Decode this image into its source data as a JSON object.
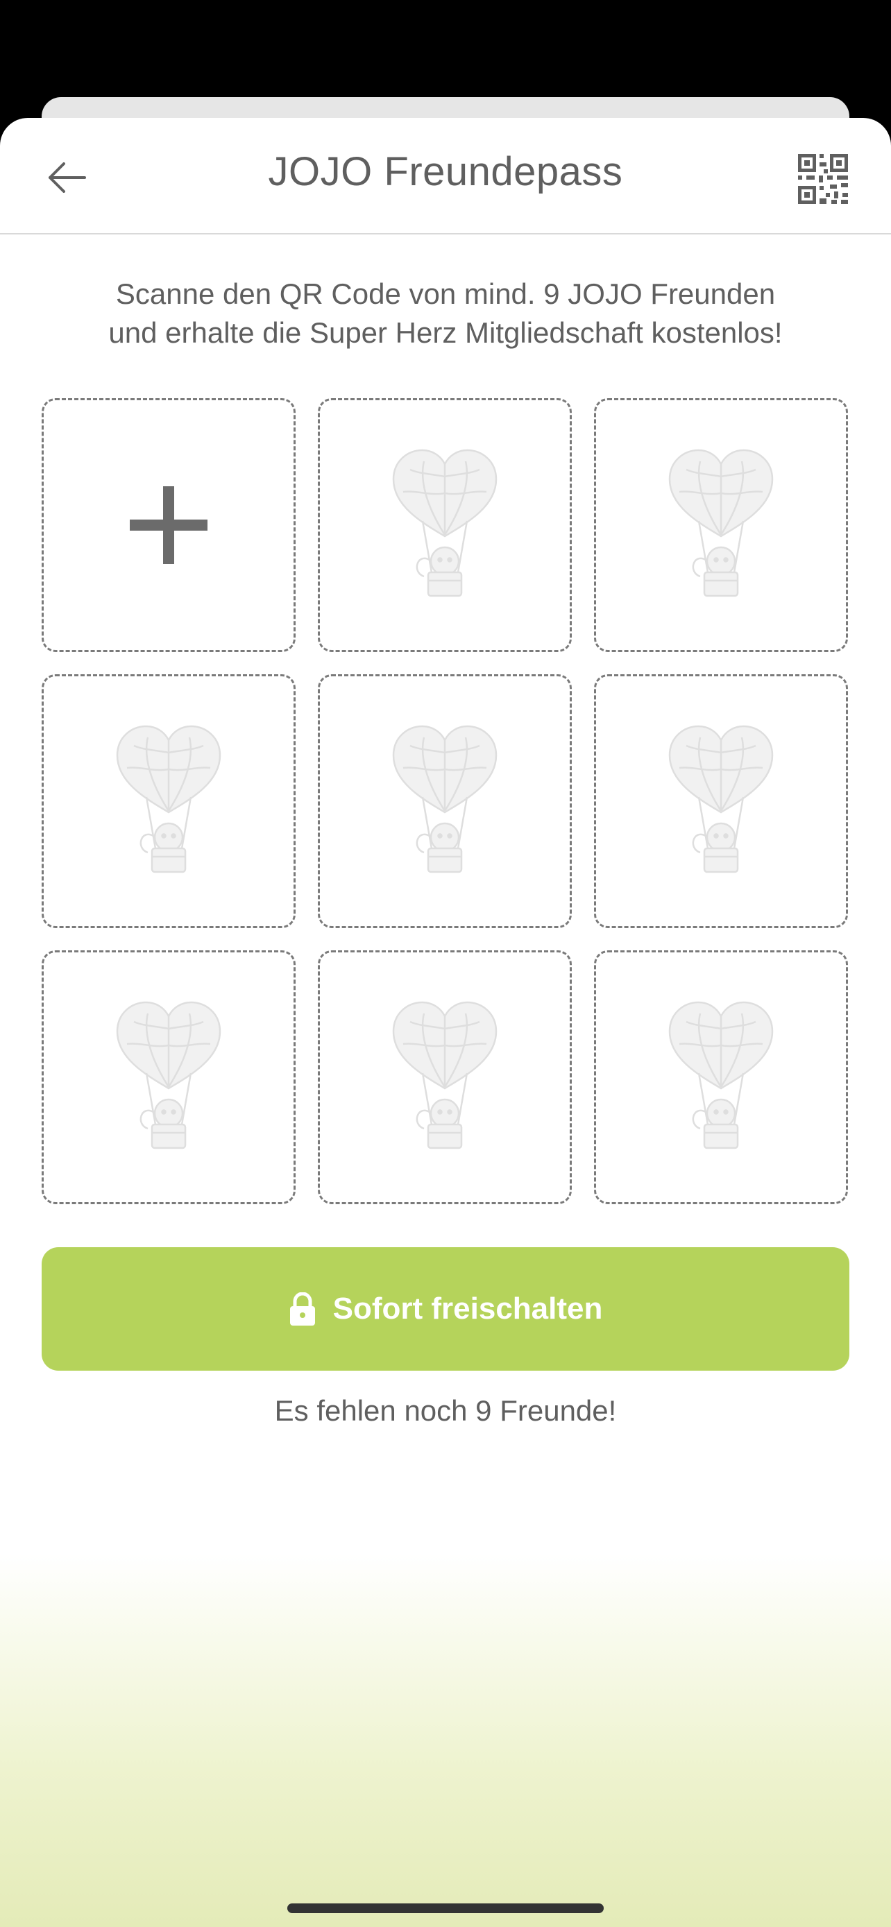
{
  "header": {
    "title": "JOJO Freundepass",
    "back_icon": "arrow-left-icon",
    "qr_icon": "qr-code-icon"
  },
  "intro": {
    "line1": "Scanne den QR Code von mind. 9 JOJO Freunden",
    "line2": "und erhalte die Super Herz Mitgliedschaft kostenlos!"
  },
  "slots": [
    {
      "type": "add",
      "icon": "plus-icon"
    },
    {
      "type": "empty",
      "icon": "heart-balloon-monkey-icon"
    },
    {
      "type": "empty",
      "icon": "heart-balloon-monkey-icon"
    },
    {
      "type": "empty",
      "icon": "heart-balloon-monkey-icon"
    },
    {
      "type": "empty",
      "icon": "heart-balloon-monkey-icon"
    },
    {
      "type": "empty",
      "icon": "heart-balloon-monkey-icon"
    },
    {
      "type": "empty",
      "icon": "heart-balloon-monkey-icon"
    },
    {
      "type": "empty",
      "icon": "heart-balloon-monkey-icon"
    },
    {
      "type": "empty",
      "icon": "heart-balloon-monkey-icon"
    }
  ],
  "cta": {
    "label": "Sofort freischalten",
    "icon": "lock-icon",
    "color": "#b5d35b"
  },
  "status": {
    "missing_text": "Es fehlen noch 9 Freunde!"
  },
  "colors": {
    "text": "#5f5f5f",
    "accent": "#b5d35b",
    "background_bottom": "#e4ebb8"
  }
}
